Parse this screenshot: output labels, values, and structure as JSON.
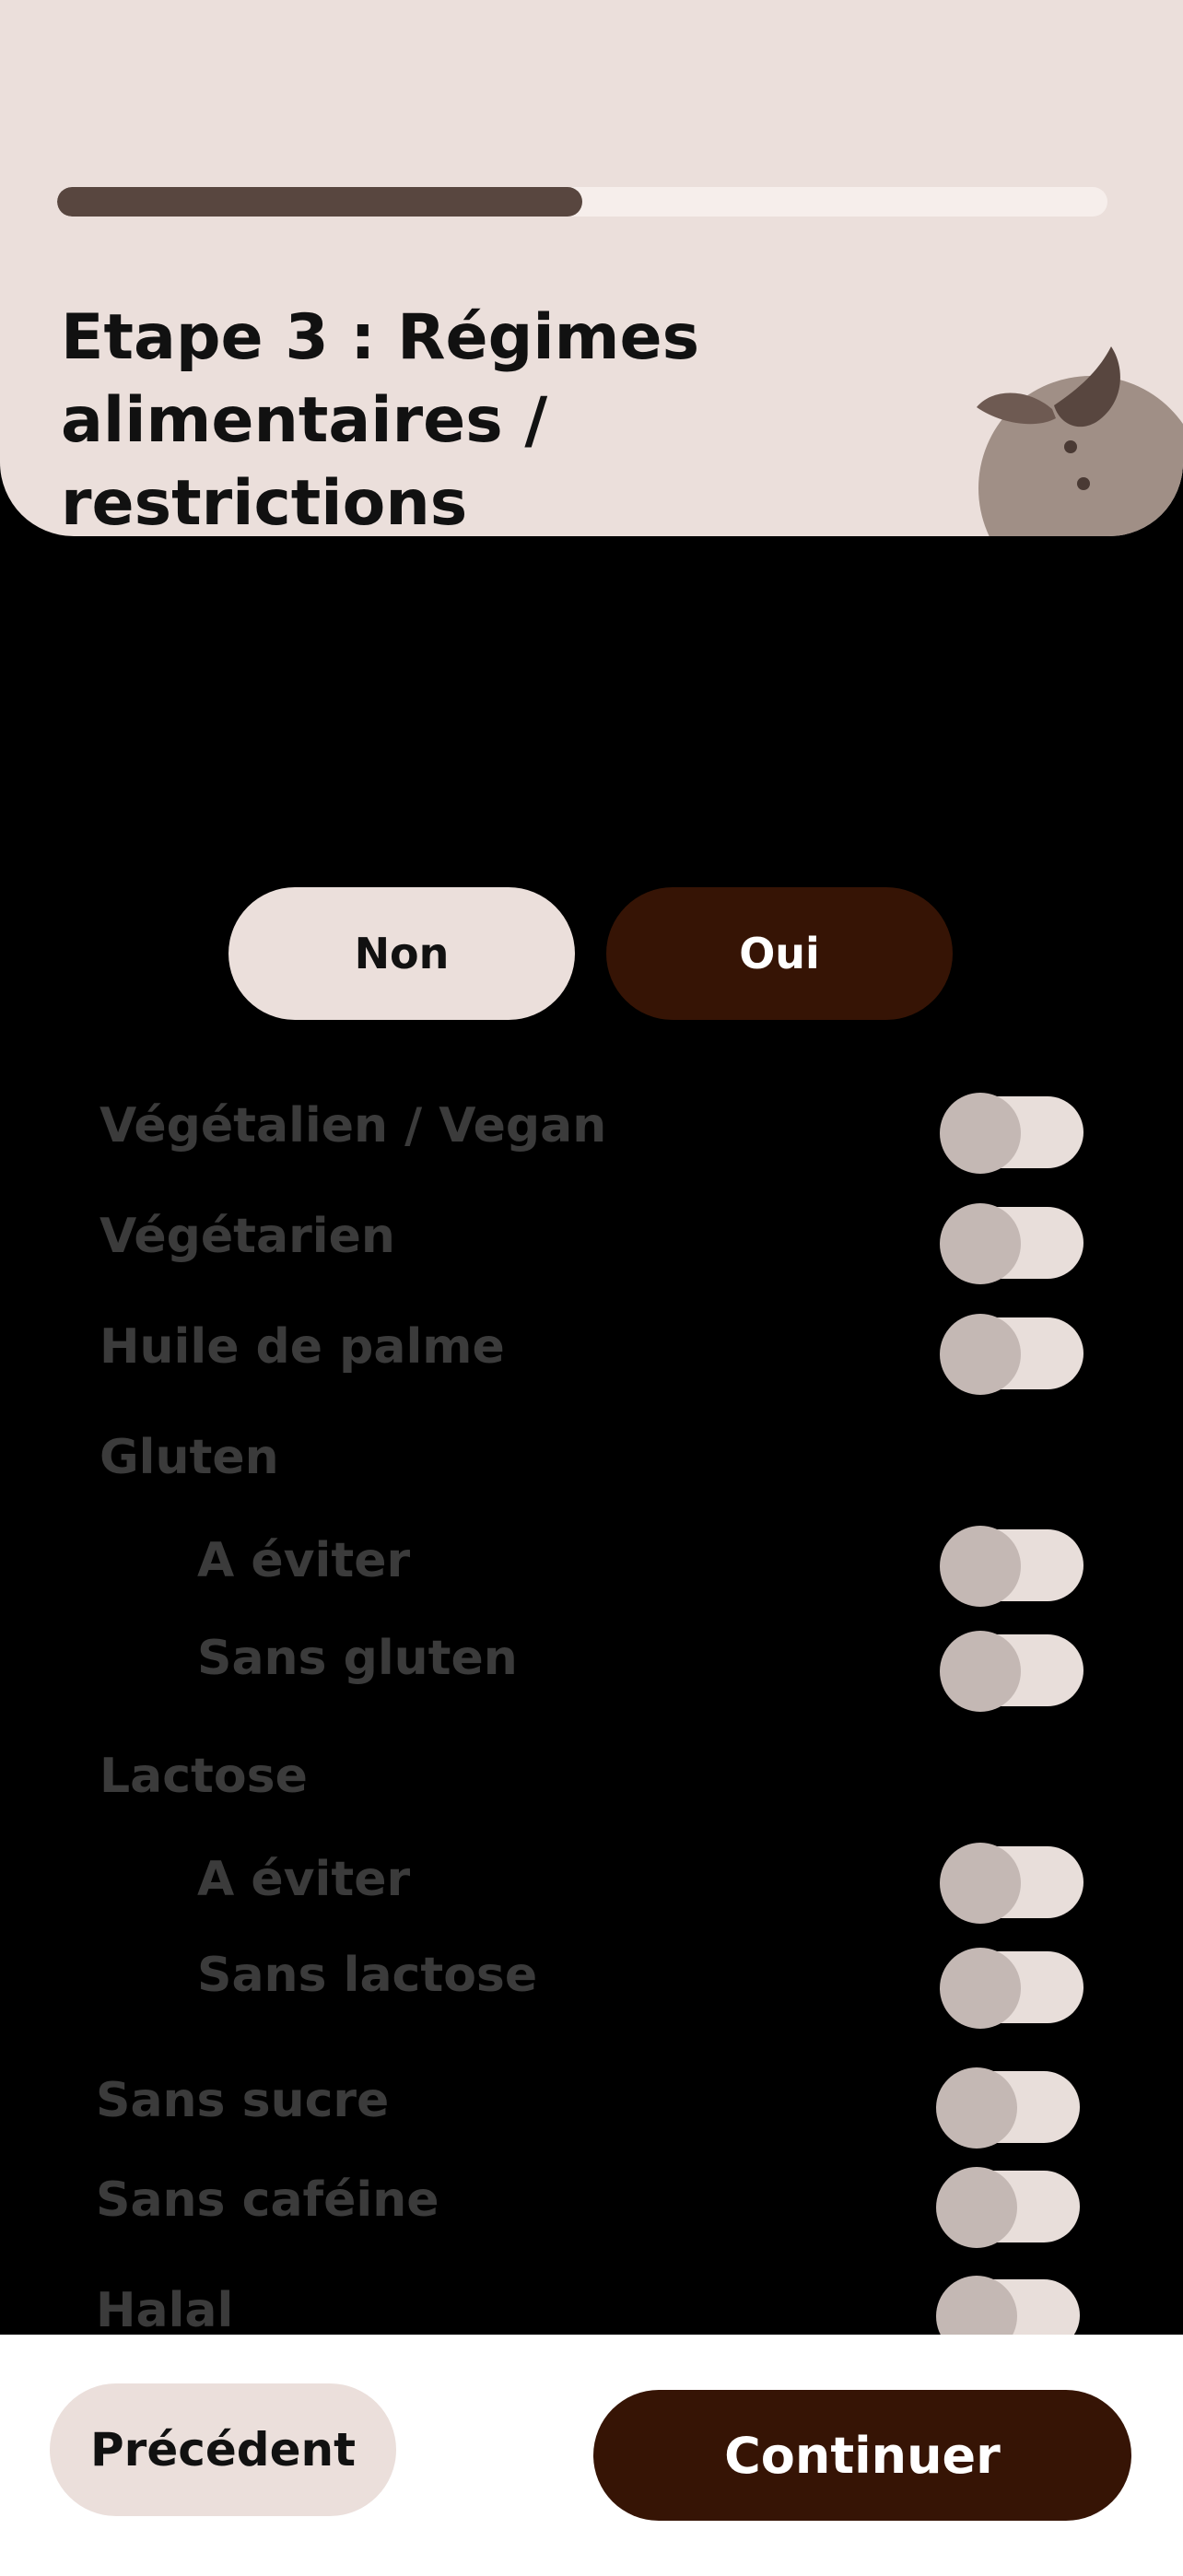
{
  "progress": {
    "fraction": 0.5
  },
  "header": {
    "title": "Etape 3 : Régimes alimentaires / restrictions"
  },
  "choice": {
    "non_label": "Non",
    "oui_label": "Oui"
  },
  "options": [
    {
      "label": "Végétalien / Vegan",
      "toggle": "off"
    },
    {
      "label": "Végétarien",
      "toggle": "off"
    },
    {
      "label": "Huile de palme",
      "toggle": "off"
    },
    {
      "label": "Gluten"
    },
    {
      "label": "A éviter",
      "toggle": "off"
    },
    {
      "label": "Sans gluten",
      "toggle": "off"
    },
    {
      "label": "Lactose"
    },
    {
      "label": "A éviter",
      "toggle": "off"
    },
    {
      "label": "Sans lactose",
      "toggle": "off"
    },
    {
      "label": "Sans sucre",
      "toggle": "off"
    },
    {
      "label": "Sans caféine",
      "toggle": "off"
    },
    {
      "label": "Halal",
      "toggle": "off"
    }
  ],
  "footer": {
    "previous_label": "Précédent",
    "continue_label": "Continuer"
  },
  "colors": {
    "header_bg": "#EBDFDB",
    "progress_fill": "#58463F",
    "dark_brown": "#361405",
    "disabled_text": "#3B3B3B"
  }
}
